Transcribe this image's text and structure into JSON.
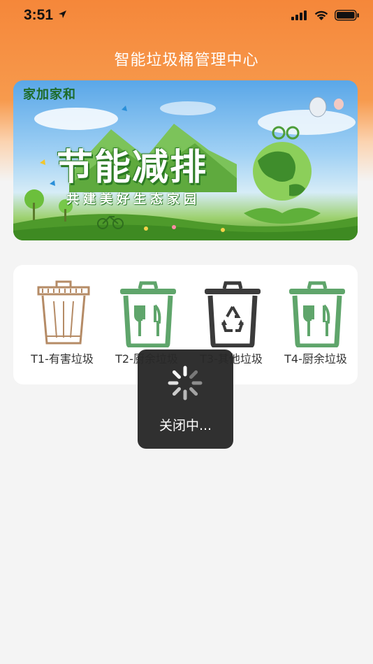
{
  "status_bar": {
    "time": "3:51",
    "location_icon": "location-arrow-icon",
    "signal_icon": "cellular-signal-icon",
    "wifi_icon": "wifi-icon",
    "battery_icon": "battery-full-icon"
  },
  "header": {
    "title": "智能垃圾桶管理中心",
    "accent_color": "#f5873a"
  },
  "banner": {
    "brand": "家加家和",
    "slogan": "节能减排",
    "subtitle": "共建美好生态家园"
  },
  "bins": [
    {
      "label": "T1-有害垃圾",
      "icon": "hazardous-bin-icon",
      "color": "#b58b66"
    },
    {
      "label": "T2-厨余垃圾",
      "icon": "kitchen-waste-bin-icon",
      "color": "#5fa56b"
    },
    {
      "label": "T3-其他垃圾",
      "icon": "recycle-bin-icon",
      "color": "#3b3b3b"
    },
    {
      "label": "T4-厨余垃圾",
      "icon": "kitchen-waste-bin-icon",
      "color": "#5fa56b"
    }
  ],
  "toast": {
    "text": "关闭中...",
    "icon": "loading-spinner-icon"
  }
}
